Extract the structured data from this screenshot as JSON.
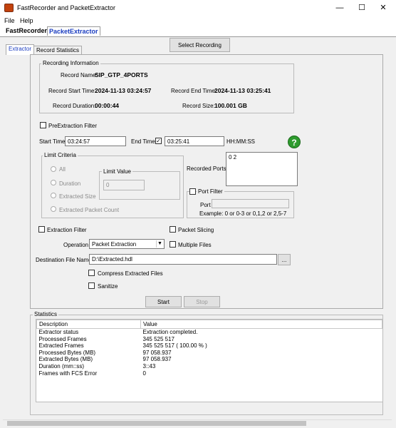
{
  "window": {
    "title": "FastRecorder and PacketExtractor",
    "minimize": "—",
    "maximize": "☐",
    "close": "✕"
  },
  "menu": [
    "File",
    "Help"
  ],
  "app_tabs": [
    "FastRecorder",
    "PacketExtractor"
  ],
  "sub_tabs": [
    "Extractor",
    "Record Statistics"
  ],
  "select_recording": "Select Recording",
  "recording_info": {
    "group_label": "Recording Information",
    "record_name_label": "Record Name:",
    "record_name": "SIP_GTP_4PORTS",
    "start_time_label": "Record Start Time:",
    "start_time": "2024-11-13 03:24:57",
    "end_time_label": "Record End Time:",
    "end_time": "2024-11-13 03:25:41",
    "duration_label": "Record Duration:",
    "duration": "00:00:44",
    "size_label": "Record Size:",
    "size": "100.001 GB"
  },
  "preextraction": {
    "label": "PreExtraction Filter",
    "start_label": "Start Time",
    "start_value": "03:24:57",
    "end_label": "End Time",
    "end_value": "03:25:41",
    "format": "HH:MM:SS",
    "help_icon": "?"
  },
  "limit": {
    "group_label": "Limit Criteria",
    "options": [
      "All",
      "Duration",
      "Extracted Size",
      "Extracted Packet Count"
    ],
    "value_label": "Limit Value",
    "value": "0"
  },
  "ports": {
    "label": "Recorded Ports:",
    "values": "0    2",
    "filter_label": "Port Filter",
    "port_label": "Port",
    "example": "Example: 0 or 0-3 or 0,1,2 or 2,5-7"
  },
  "options": {
    "extraction_filter": "Extraction Filter",
    "packet_slicing": "Packet Slicing",
    "operation_label": "Operation",
    "operation_value": "Packet Extraction",
    "multiple_files": "Multiple Files",
    "destination_label": "Destination File Name",
    "destination_value": "D:\\Extracted.hdl",
    "browse": "...",
    "compress": "Compress Extracted Files",
    "sanitize": "Sanitize"
  },
  "actions": {
    "start": "Start",
    "stop": "Stop"
  },
  "statistics": {
    "group_label": "Statistics",
    "headers": [
      "Description",
      "Value"
    ],
    "rows": [
      [
        "Extractor status",
        "Extraction completed."
      ],
      [
        "Processed Frames",
        "345 525 517"
      ],
      [
        "Extracted Frames",
        "345 525 517 ( 100.00 % )"
      ],
      [
        "Processed Bytes (MB)",
        "97 058.937"
      ],
      [
        "Extracted Bytes (MB)",
        "97 058.937"
      ],
      [
        "Duration (mm::ss)",
        "3::43"
      ],
      [
        "Frames with FCS Error",
        "0"
      ]
    ]
  },
  "colors": {
    "accent": "#1a3cc0",
    "help_green": "#2e9b2e",
    "app_icon": "#c2410c"
  }
}
